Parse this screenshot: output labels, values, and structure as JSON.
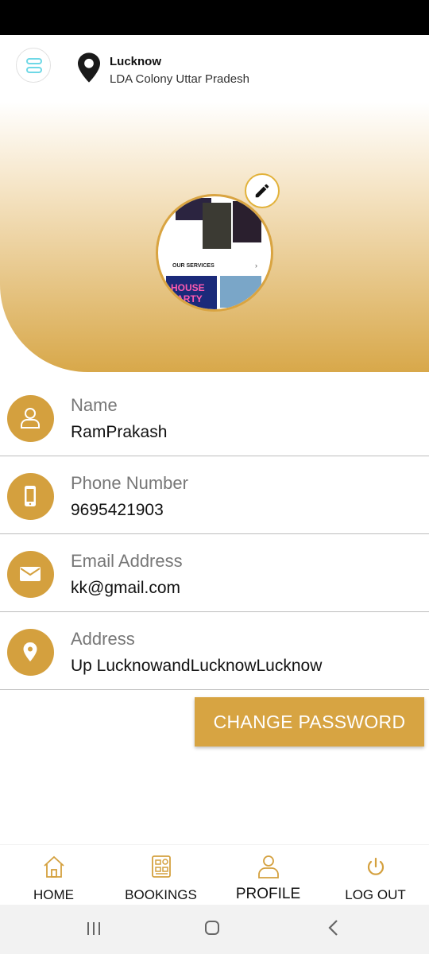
{
  "header": {
    "city": "Lucknow",
    "locality": "LDA Colony Uttar Pradesh"
  },
  "profile_image": {
    "services_label": "OUR SERVICES",
    "neon_text": "HOUSE PARTY"
  },
  "fields": [
    {
      "label": "Name",
      "value": "RamPrakash",
      "icon": "user-icon"
    },
    {
      "label": "Phone Number",
      "value": "9695421903",
      "icon": "phone-icon"
    },
    {
      "label": "Email Address",
      "value": "kk@gmail.com",
      "icon": "mail-icon"
    },
    {
      "label": "Address",
      "value": "Up LucknowandLucknowLucknow",
      "icon": "location-icon"
    }
  ],
  "change_password_label": "CHANGE PASSWORD",
  "bottom_nav": [
    {
      "label": "HOME",
      "icon": "home-icon"
    },
    {
      "label": "BOOKINGS",
      "icon": "bookings-icon"
    },
    {
      "label": "PROFILE",
      "icon": "profile-icon",
      "active": true
    },
    {
      "label": "LOG OUT",
      "icon": "power-icon"
    }
  ],
  "colors": {
    "accent": "#d4a03e",
    "menu_icon": "#6ed8e6"
  }
}
